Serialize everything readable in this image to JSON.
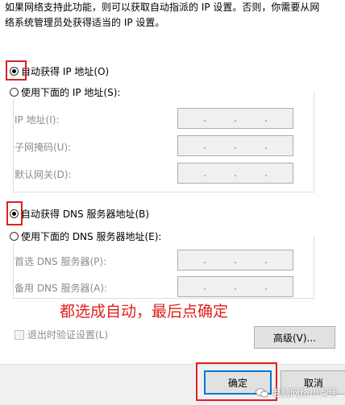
{
  "description": {
    "line1": "如果网络支持此功能，则可以获取自动指派的 IP 设置。否则，你需要从网",
    "line2": "络系统管理员处获得适当的 IP 设置。"
  },
  "ip_section": {
    "auto_label": "自动获得 IP 地址(O)",
    "manual_label": "使用下面的 IP 地址(S):",
    "fields": [
      {
        "label": "IP 地址(I):",
        "value": ". . ."
      },
      {
        "label": "子网掩码(U):",
        "value": ". . ."
      },
      {
        "label": "默认网关(D):",
        "value": ". . ."
      }
    ]
  },
  "dns_section": {
    "auto_label": "自动获得 DNS 服务器地址(B)",
    "manual_label": "使用下面的 DNS 服务器地址(E):",
    "fields": [
      {
        "label": "首选 DNS 服务器(P):",
        "value": ". . ."
      },
      {
        "label": "备用 DNS 服务器(A):",
        "value": ". . ."
      }
    ]
  },
  "annotation": "都选成自动，最后点确定",
  "validate_label": "退出时验证设置(L)",
  "buttons": {
    "advanced": "高级(V)...",
    "ok": "确定",
    "cancel": "取消"
  },
  "watermark": "电脑网络小帮手",
  "colors": {
    "highlight": "#e02020",
    "accent": "#0078d7"
  }
}
